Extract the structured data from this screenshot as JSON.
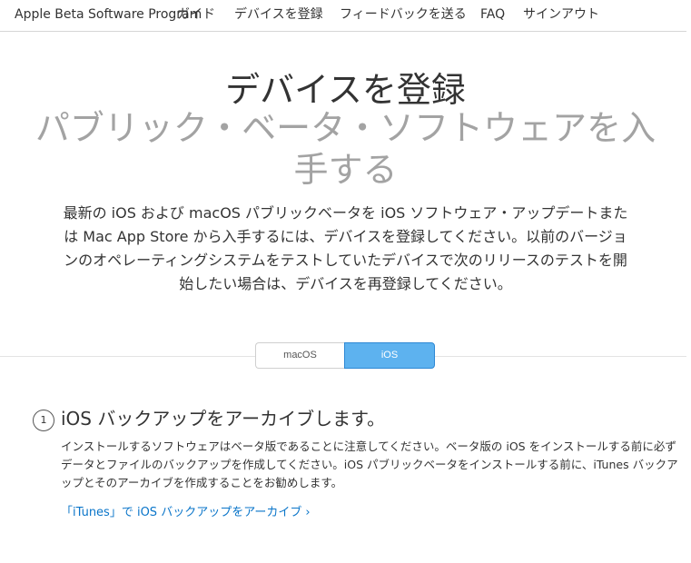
{
  "nav": {
    "brand": "Apple Beta Software Program",
    "items": [
      {
        "label": "ガイド"
      },
      {
        "label": "デバイスを登録",
        "active": true
      },
      {
        "label": "フィードバックを送る"
      },
      {
        "label": "FAQ"
      },
      {
        "label": "サインアウト"
      }
    ]
  },
  "hero": {
    "title": "デバイスを登録",
    "subtitle": "パブリック・ベータ・ソフトウェアを入手する",
    "body": "最新の iOS および macOS パブリックベータを iOS ソフトウェア・アップデートまたは Mac App Store から入手するには、デバイスを登録してください。以前のバージョンのオペレーティングシステムをテストしていたデバイスで次のリリースのテストを開始したい場合は、デバイスを再登録してください。"
  },
  "segmented": {
    "options": [
      "macOS",
      "iOS"
    ],
    "selected": "iOS"
  },
  "step": {
    "number": "1",
    "title": "iOS バックアップをアーカイブします。",
    "body": "インストールするソフトウェアはベータ版であることに注意してください。ベータ版の iOS をインストールする前に必ずデータとファイルのバックアップを作成してください。iOS パブリックベータをインストールする前に、iTunes バックアップとそのアーカイブを作成することをお勧めします。",
    "link": "「iTunes」で iOS バックアップをアーカイブ",
    "link_chevron": "›"
  },
  "colors": {
    "text": "#333333",
    "subtitle_gray": "#a3a3a3",
    "link_blue": "#0a75c9",
    "segment_selected": "#5db2ef"
  },
  "icons": {
    "link_chevron": "chevron-right-icon"
  }
}
